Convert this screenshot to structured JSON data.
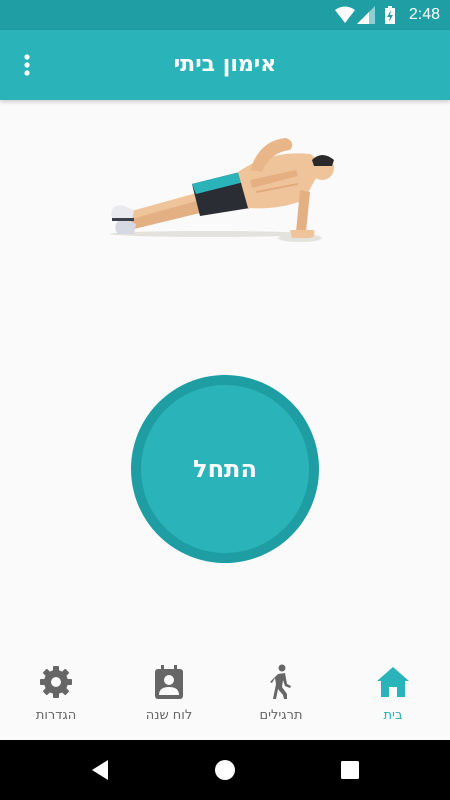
{
  "status_bar": {
    "time": "2:48"
  },
  "app_bar": {
    "title": "אימון ביתי",
    "menu_icon": "more-vert-icon"
  },
  "colors": {
    "primary": "#2ab3b8",
    "primary_dark": "#1f9ea3",
    "inactive": "#666666"
  },
  "hero": {
    "image": "side-plank-illustration"
  },
  "start_button": {
    "label": "התחל"
  },
  "bottom_nav": {
    "items": [
      {
        "label": "בית",
        "icon": "home-icon",
        "active": true
      },
      {
        "label": "תרגילים",
        "icon": "walk-icon",
        "active": false
      },
      {
        "label": "לוח שנה",
        "icon": "calendar-person-icon",
        "active": false
      },
      {
        "label": "הגדרות",
        "icon": "gear-icon",
        "active": false
      }
    ]
  },
  "system_nav": {
    "back": "back-icon",
    "home": "home-circle-icon",
    "recents": "recents-icon"
  }
}
